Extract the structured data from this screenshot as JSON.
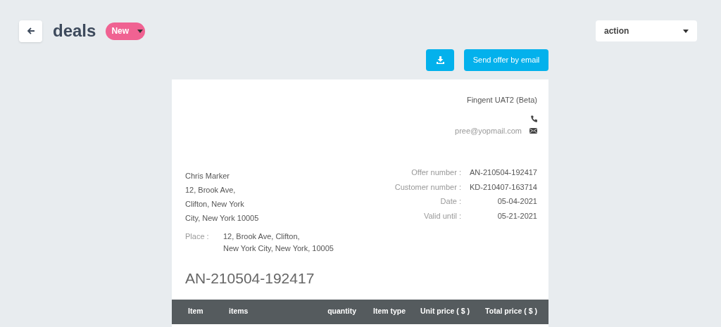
{
  "header": {
    "title": "deals",
    "status": "New",
    "action_select": "action"
  },
  "buttons": {
    "send_email": "Send offer by email"
  },
  "offer": {
    "company": "Fingent UAT2 (Beta)",
    "email": "pree@yopmail.com",
    "address": [
      "Chris Marker",
      "12, Brook Ave,",
      "Clifton, New York",
      "City, New York 10005"
    ],
    "details": [
      {
        "label": "Offer number :",
        "value": "AN-210504-192417"
      },
      {
        "label": "Customer number :",
        "value": "KD-210407-163714"
      },
      {
        "label": "Date :",
        "value": "05-04-2021"
      },
      {
        "label": "Valid until :",
        "value": "05-21-2021"
      }
    ],
    "place_label": "Place :",
    "place": [
      "12, Brook Ave, Clifton,",
      "New York City, New York, 10005"
    ],
    "number": "AN-210504-192417",
    "table": {
      "columns": [
        "Item",
        "items",
        "quantity",
        "Item type",
        "Unit price ( $ )",
        "Total price ( $ )"
      ]
    }
  }
}
